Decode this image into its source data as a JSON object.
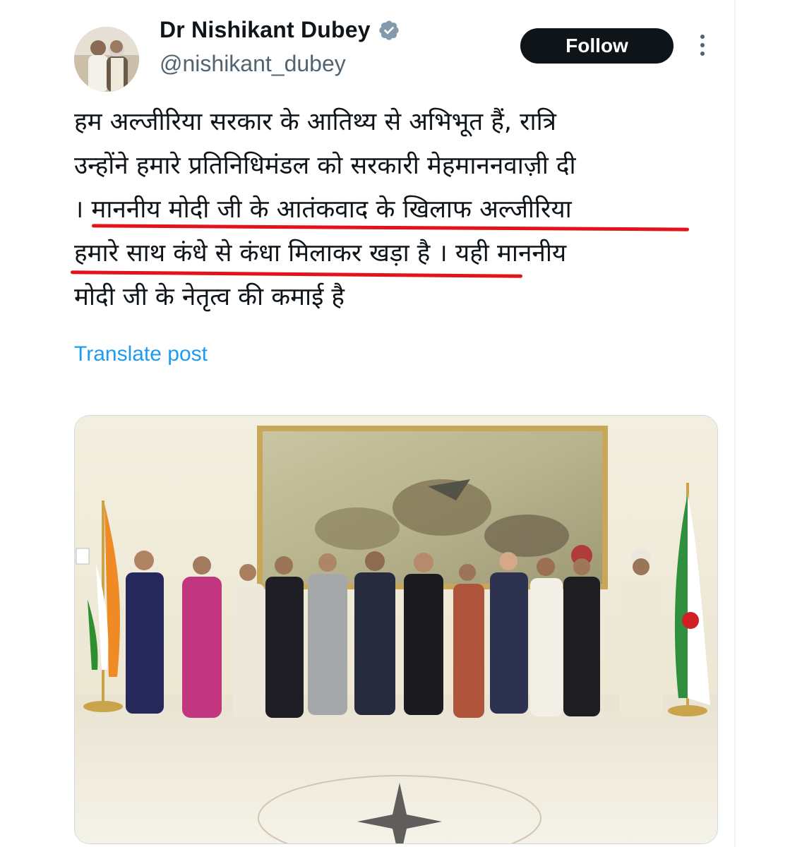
{
  "author": {
    "display_name": "Dr Nishikant Dubey",
    "handle": "@nishikant_dubey",
    "verified_icon": "verified-badge-icon"
  },
  "actions": {
    "follow_label": "Follow",
    "more_icon": "more-options-icon"
  },
  "post": {
    "lines": [
      "हम अल्जीरिया सरकार के आतिथ्य से अभिभूत हैं, रात्रि",
      "उन्होंने हमारे प्रतिनिधिमंडल को सरकारी मेहमाननवाज़ी दी",
      "। माननीय मोदी जी के आतंकवाद के खिलाफ अल्जीरिया",
      "हमारे साथ कंधे से कंधा मिलाकर खड़ा है । यही माननीय",
      "मोदी जी के नेतृत्व की कमाई है"
    ],
    "translate_label": "Translate post"
  },
  "colors": {
    "link": "#1d9bf0",
    "follow_bg": "#0f1419",
    "underline": "#e3131b",
    "verified": "#829aab"
  }
}
